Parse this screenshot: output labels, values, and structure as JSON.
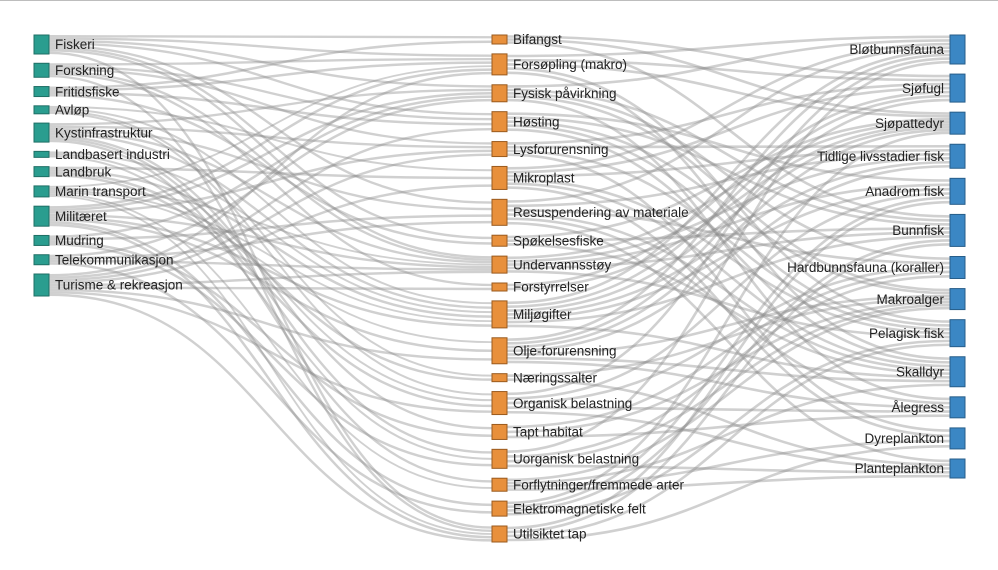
{
  "chart_data": {
    "type": "sankey",
    "title": "",
    "colors": {
      "source": "#2a9d8f",
      "source_stroke": "#1f6f65",
      "pressure": "#e8903c",
      "pressure_stroke": "#9a5a1e",
      "receptor": "#3b87c4",
      "receptor_stroke": "#275e8a",
      "link": "#8a8a8a"
    },
    "columns": [
      {
        "name": "aktiviteter",
        "color_key": "source",
        "label_side": "right",
        "nodes": [
          {
            "id": "fiskeri",
            "label": "Fiskeri",
            "value": 19
          },
          {
            "id": "forskning",
            "label": "Forskning",
            "value": 14
          },
          {
            "id": "fritidsfiske",
            "label": "Fritidsfiske",
            "value": 10
          },
          {
            "id": "avlop",
            "label": "Avløp",
            "value": 8
          },
          {
            "id": "kystinfrastruktur",
            "label": "Kystinfrastruktur",
            "value": 19
          },
          {
            "id": "landbasert-industri",
            "label": "Landbasert industri",
            "value": 6
          },
          {
            "id": "landbruk",
            "label": "Landbruk",
            "value": 10
          },
          {
            "id": "marin-transport",
            "label": "Marin transport",
            "value": 11
          },
          {
            "id": "militaeret",
            "label": "Militæret",
            "value": 20
          },
          {
            "id": "mudring",
            "label": "Mudring",
            "value": 10
          },
          {
            "id": "telekommunikasjon",
            "label": "Telekommunikasjon",
            "value": 10
          },
          {
            "id": "turisme",
            "label": "Turisme & rekreasjon",
            "value": 22
          }
        ]
      },
      {
        "name": "pavirkninger",
        "color_key": "pressure",
        "label_side": "right",
        "nodes": [
          {
            "id": "bifangst",
            "label": "Bifangst",
            "value": 9
          },
          {
            "id": "forsopling",
            "label": "Forsøpling (makro)",
            "value": 21
          },
          {
            "id": "fysisk",
            "label": "Fysisk påvirkning",
            "value": 17
          },
          {
            "id": "hosting",
            "label": "Høsting",
            "value": 20
          },
          {
            "id": "lys",
            "label": "Lysforurensning",
            "value": 15
          },
          {
            "id": "mikroplast",
            "label": "Mikroplast",
            "value": 23
          },
          {
            "id": "resuspendering",
            "label": "Resuspendering av materiale",
            "value": 26
          },
          {
            "id": "spokelsesfiske",
            "label": "Spøkelsesfiske",
            "value": 11
          },
          {
            "id": "stoy",
            "label": "Undervannsstøy",
            "value": 17
          },
          {
            "id": "forstyrrelser",
            "label": "Forstyrrelser",
            "value": 8
          },
          {
            "id": "miljogifter",
            "label": "Miljøgifter",
            "value": 27
          },
          {
            "id": "olje",
            "label": "Olje-forurensning",
            "value": 26
          },
          {
            "id": "naeringssalter",
            "label": "Næringssalter",
            "value": 8
          },
          {
            "id": "organisk",
            "label": "Organisk belastning",
            "value": 23
          },
          {
            "id": "tapt-habitat",
            "label": "Tapt habitat",
            "value": 15
          },
          {
            "id": "uorganisk",
            "label": "Uorganisk belastning",
            "value": 19
          },
          {
            "id": "forflytninger",
            "label": "Forflytninger/fremmede arter",
            "value": 13
          },
          {
            "id": "elektromagnetiske",
            "label": "Elektromagnetiske felt",
            "value": 15
          },
          {
            "id": "utilsiktet",
            "label": "Utilsiktet tap",
            "value": 16
          }
        ]
      },
      {
        "name": "okosystemkomponenter",
        "color_key": "receptor",
        "label_side": "left",
        "nodes": [
          {
            "id": "blotbunn",
            "label": "Bløtbunnsfauna",
            "value": 29
          },
          {
            "id": "sjofugl",
            "label": "Sjøfugl",
            "value": 28
          },
          {
            "id": "sjopattedyr",
            "label": "Sjøpattedyr",
            "value": 22
          },
          {
            "id": "tidlige",
            "label": "Tidlige livsstadier fisk",
            "value": 24
          },
          {
            "id": "anadrom",
            "label": "Anadrom fisk",
            "value": 26
          },
          {
            "id": "bunnfisk",
            "label": "Bunnfisk",
            "value": 32
          },
          {
            "id": "hardbunn",
            "label": "Hardbunnsfauna (koraller)",
            "value": 22
          },
          {
            "id": "makroalger",
            "label": "Makroalger",
            "value": 21
          },
          {
            "id": "pelagisk",
            "label": "Pelagisk fisk",
            "value": 27
          },
          {
            "id": "skalldyr",
            "label": "Skalldyr",
            "value": 30
          },
          {
            "id": "alegress",
            "label": "Ålegress",
            "value": 21
          },
          {
            "id": "dyreplankton",
            "label": "Dyreplankton",
            "value": 21
          },
          {
            "id": "planteplankton",
            "label": "Planteplankton",
            "value": 19
          }
        ]
      }
    ],
    "links_stage1": [
      [
        "fiskeri",
        "bifangst"
      ],
      [
        "fiskeri",
        "forsopling"
      ],
      [
        "fiskeri",
        "fysisk"
      ],
      [
        "fiskeri",
        "hosting"
      ],
      [
        "fiskeri",
        "resuspendering"
      ],
      [
        "fiskeri",
        "spokelsesfiske"
      ],
      [
        "fiskeri",
        "stoy"
      ],
      [
        "fiskeri",
        "utilsiktet"
      ],
      [
        "forskning",
        "forsopling"
      ],
      [
        "forskning",
        "hosting"
      ],
      [
        "forskning",
        "lys"
      ],
      [
        "forskning",
        "stoy"
      ],
      [
        "forskning",
        "forstyrrelser"
      ],
      [
        "forskning",
        "utilsiktet"
      ],
      [
        "fritidsfiske",
        "bifangst"
      ],
      [
        "fritidsfiske",
        "hosting"
      ],
      [
        "fritidsfiske",
        "spokelsesfiske"
      ],
      [
        "fritidsfiske",
        "forsopling"
      ],
      [
        "avlop",
        "mikroplast"
      ],
      [
        "avlop",
        "miljogifter"
      ],
      [
        "avlop",
        "naeringssalter"
      ],
      [
        "avlop",
        "organisk"
      ],
      [
        "kystinfrastruktur",
        "fysisk"
      ],
      [
        "kystinfrastruktur",
        "lys"
      ],
      [
        "kystinfrastruktur",
        "resuspendering"
      ],
      [
        "kystinfrastruktur",
        "stoy"
      ],
      [
        "kystinfrastruktur",
        "miljogifter"
      ],
      [
        "kystinfrastruktur",
        "tapt-habitat"
      ],
      [
        "kystinfrastruktur",
        "uorganisk"
      ],
      [
        "kystinfrastruktur",
        "forflytninger"
      ],
      [
        "landbasert-industri",
        "miljogifter"
      ],
      [
        "landbasert-industri",
        "organisk"
      ],
      [
        "landbasert-industri",
        "uorganisk"
      ],
      [
        "landbruk",
        "naeringssalter"
      ],
      [
        "landbruk",
        "miljogifter"
      ],
      [
        "landbruk",
        "mikroplast"
      ],
      [
        "landbruk",
        "organisk"
      ],
      [
        "marin-transport",
        "forsopling"
      ],
      [
        "marin-transport",
        "stoy"
      ],
      [
        "marin-transport",
        "olje"
      ],
      [
        "marin-transport",
        "forflytninger"
      ],
      [
        "marin-transport",
        "miljogifter"
      ],
      [
        "marin-transport",
        "utilsiktet"
      ],
      [
        "militaeret",
        "forsopling"
      ],
      [
        "militaeret",
        "fysisk"
      ],
      [
        "militaeret",
        "stoy"
      ],
      [
        "militaeret",
        "miljogifter"
      ],
      [
        "militaeret",
        "olje"
      ],
      [
        "militaeret",
        "elektromagnetiske"
      ],
      [
        "militaeret",
        "lys"
      ],
      [
        "militaeret",
        "utilsiktet"
      ],
      [
        "mudring",
        "resuspendering"
      ],
      [
        "mudring",
        "fysisk"
      ],
      [
        "mudring",
        "tapt-habitat"
      ],
      [
        "mudring",
        "uorganisk"
      ],
      [
        "telekommunikasjon",
        "fysisk"
      ],
      [
        "telekommunikasjon",
        "elektromagnetiske"
      ],
      [
        "telekommunikasjon",
        "resuspendering"
      ],
      [
        "telekommunikasjon",
        "stoy"
      ],
      [
        "turisme",
        "forsopling"
      ],
      [
        "turisme",
        "mikroplast"
      ],
      [
        "turisme",
        "lys"
      ],
      [
        "turisme",
        "stoy"
      ],
      [
        "turisme",
        "forstyrrelser"
      ],
      [
        "turisme",
        "olje"
      ],
      [
        "turisme",
        "organisk"
      ],
      [
        "turisme",
        "hosting"
      ],
      [
        "turisme",
        "utilsiktet"
      ]
    ],
    "links_stage2": [
      [
        "bifangst",
        "sjofugl"
      ],
      [
        "bifangst",
        "sjopattedyr"
      ],
      [
        "bifangst",
        "bunnfisk"
      ],
      [
        "forsopling",
        "sjofugl"
      ],
      [
        "forsopling",
        "sjopattedyr"
      ],
      [
        "forsopling",
        "blotbunn"
      ],
      [
        "forsopling",
        "pelagisk"
      ],
      [
        "forsopling",
        "skalldyr"
      ],
      [
        "fysisk",
        "blotbunn"
      ],
      [
        "fysisk",
        "hardbunn"
      ],
      [
        "fysisk",
        "makroalger"
      ],
      [
        "fysisk",
        "alegress"
      ],
      [
        "fysisk",
        "bunnfisk"
      ],
      [
        "hosting",
        "bunnfisk"
      ],
      [
        "hosting",
        "pelagisk"
      ],
      [
        "hosting",
        "skalldyr"
      ],
      [
        "hosting",
        "anadrom"
      ],
      [
        "hosting",
        "makroalger"
      ],
      [
        "lys",
        "sjofugl"
      ],
      [
        "lys",
        "tidlige"
      ],
      [
        "lys",
        "dyreplankton"
      ],
      [
        "lys",
        "pelagisk"
      ],
      [
        "mikroplast",
        "dyreplankton"
      ],
      [
        "mikroplast",
        "skalldyr"
      ],
      [
        "mikroplast",
        "sjofugl"
      ],
      [
        "mikroplast",
        "pelagisk"
      ],
      [
        "mikroplast",
        "blotbunn"
      ],
      [
        "mikroplast",
        "tidlige"
      ],
      [
        "resuspendering",
        "blotbunn"
      ],
      [
        "resuspendering",
        "hardbunn"
      ],
      [
        "resuspendering",
        "alegress"
      ],
      [
        "resuspendering",
        "tidlige"
      ],
      [
        "resuspendering",
        "planteplankton"
      ],
      [
        "resuspendering",
        "skalldyr"
      ],
      [
        "spokelsesfiske",
        "bunnfisk"
      ],
      [
        "spokelsesfiske",
        "skalldyr"
      ],
      [
        "spokelsesfiske",
        "sjopattedyr"
      ],
      [
        "stoy",
        "sjopattedyr"
      ],
      [
        "stoy",
        "tidlige"
      ],
      [
        "stoy",
        "pelagisk"
      ],
      [
        "stoy",
        "bunnfisk"
      ],
      [
        "stoy",
        "anadrom"
      ],
      [
        "forstyrrelser",
        "sjofugl"
      ],
      [
        "forstyrrelser",
        "sjopattedyr"
      ],
      [
        "miljogifter",
        "sjofugl"
      ],
      [
        "miljogifter",
        "sjopattedyr"
      ],
      [
        "miljogifter",
        "bunnfisk"
      ],
      [
        "miljogifter",
        "skalldyr"
      ],
      [
        "miljogifter",
        "blotbunn"
      ],
      [
        "miljogifter",
        "anadrom"
      ],
      [
        "miljogifter",
        "tidlige"
      ],
      [
        "olje",
        "sjofugl"
      ],
      [
        "olje",
        "sjopattedyr"
      ],
      [
        "olje",
        "tidlige"
      ],
      [
        "olje",
        "skalldyr"
      ],
      [
        "olje",
        "makroalger"
      ],
      [
        "olje",
        "alegress"
      ],
      [
        "olje",
        "blotbunn"
      ],
      [
        "naeringssalter",
        "planteplankton"
      ],
      [
        "naeringssalter",
        "makroalger"
      ],
      [
        "organisk",
        "blotbunn"
      ],
      [
        "organisk",
        "alegress"
      ],
      [
        "organisk",
        "planteplankton"
      ],
      [
        "organisk",
        "hardbunn"
      ],
      [
        "organisk",
        "anadrom"
      ],
      [
        "tapt-habitat",
        "alegress"
      ],
      [
        "tapt-habitat",
        "makroalger"
      ],
      [
        "tapt-habitat",
        "hardbunn"
      ],
      [
        "uorganisk",
        "hardbunn"
      ],
      [
        "uorganisk",
        "blotbunn"
      ],
      [
        "uorganisk",
        "makroalger"
      ],
      [
        "uorganisk",
        "planteplankton"
      ],
      [
        "forflytninger",
        "makroalger"
      ],
      [
        "forflytninger",
        "skalldyr"
      ],
      [
        "forflytninger",
        "planteplankton"
      ],
      [
        "forflytninger",
        "dyreplankton"
      ],
      [
        "elektromagnetiske",
        "anadrom"
      ],
      [
        "elektromagnetiske",
        "bunnfisk"
      ],
      [
        "elektromagnetiske",
        "pelagisk"
      ],
      [
        "elektromagnetiske",
        "sjopattedyr"
      ],
      [
        "utilsiktet",
        "bunnfisk"
      ],
      [
        "utilsiktet",
        "pelagisk"
      ],
      [
        "utilsiktet",
        "anadrom"
      ],
      [
        "utilsiktet",
        "dyreplankton"
      ]
    ]
  }
}
